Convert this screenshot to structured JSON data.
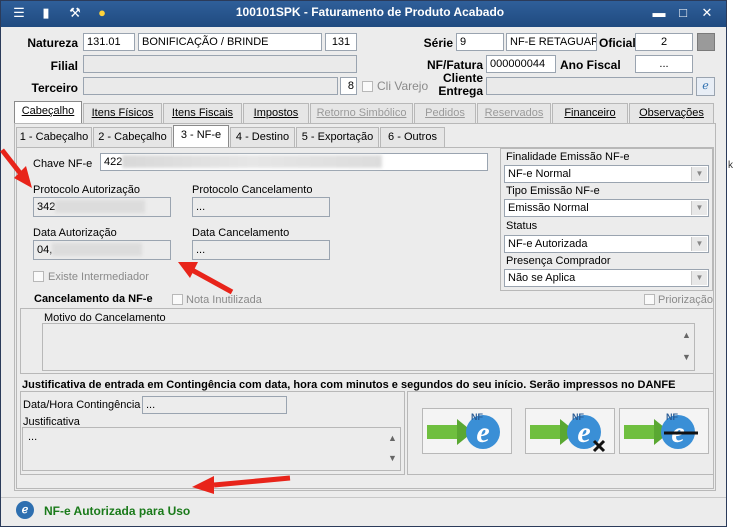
{
  "window": {
    "title": "100101SPK - Faturamento de Produto Acabado",
    "controls": {
      "minimize": "▬",
      "maximize": "□",
      "close": "✕"
    }
  },
  "header": {
    "natureza": {
      "label": "Natureza",
      "code": "131.01",
      "description": "BONIFICAÇÃO / BRINDE",
      "number": "131"
    },
    "filial": {
      "label": "Filial",
      "value": ""
    },
    "terceiro": {
      "label": "Terceiro",
      "number": "8"
    },
    "cli_varejo": {
      "label": "Cli Varejo"
    },
    "serie": {
      "label": "Série",
      "value": "9",
      "description": "NF-E RETAGUARD"
    },
    "oficial": {
      "label": "Oficial",
      "value": "2"
    },
    "nf_fatura": {
      "label": "NF/Fatura",
      "value": "000000044"
    },
    "ano_fiscal": {
      "label": "Ano Fiscal",
      "value": "..."
    },
    "cliente_entrega": {
      "label": "Cliente Entrega",
      "value": ""
    }
  },
  "tabs": [
    {
      "label": "Cabeçalho",
      "state": "active"
    },
    {
      "label": "Itens Físicos",
      "state": "normal"
    },
    {
      "label": "Itens Fiscais",
      "state": "normal"
    },
    {
      "label": "Impostos",
      "state": "normal"
    },
    {
      "label": "Retorno Simbólico",
      "state": "disabled"
    },
    {
      "label": "Pedidos",
      "state": "disabled"
    },
    {
      "label": "Reservados",
      "state": "disabled"
    },
    {
      "label": "Financeiro",
      "state": "normal"
    },
    {
      "label": "Observações",
      "state": "normal"
    }
  ],
  "subtabs": [
    {
      "label": "1 - Cabeçalho"
    },
    {
      "label": "2 - Cabeçalho"
    },
    {
      "label": "3 - NF-e"
    },
    {
      "label": "4 - Destino"
    },
    {
      "label": "5 - Exportação"
    },
    {
      "label": "6 - Outros"
    }
  ],
  "nfe": {
    "chave_label": "Chave NF-e",
    "chave_value": "422",
    "protocolo_autorizacao_label": "Protocolo Autorização",
    "protocolo_autorizacao_value": "342",
    "protocolo_cancelamento_label": "Protocolo Cancelamento",
    "protocolo_cancelamento_value": "...",
    "data_autorizacao_label": "Data Autorização",
    "data_autorizacao_value": "04,",
    "data_cancelamento_label": "Data Cancelamento",
    "data_cancelamento_value": "...",
    "existe_intermediador": "Existe Intermediador"
  },
  "right_panel": {
    "finalidade_label": "Finalidade Emissão NF-e",
    "finalidade_value": "NF-e Normal",
    "tipo_label": "Tipo Emissão NF-e",
    "tipo_value": "Emissão Normal",
    "status_label": "Status",
    "status_value": "NF-e Autorizada",
    "presenca_label": "Presença Comprador",
    "presenca_value": "Não se Aplica"
  },
  "cancelamento": {
    "title": "Cancelamento da NF-e",
    "nota_inutilizada": "Nota Inutilizada",
    "priorizacao": "Priorização",
    "motivo_label": "Motivo do Cancelamento"
  },
  "contingencia": {
    "title": "Justificativa de entrada em Contingência com data, hora com minutos e segundos do seu início. Serão impressos no DANFE",
    "datahora_label": "Data/Hora Contingência",
    "datahora_value": "...",
    "justificativa_label": "Justificativa",
    "justificativa_value": "..."
  },
  "nfe_buttons": [
    {
      "name": "send",
      "text": "NF"
    },
    {
      "name": "cancel",
      "text": "NF"
    },
    {
      "name": "inutilize",
      "text": "NF"
    }
  ],
  "status_bar": {
    "text": "NF-e Autorizada para Uso",
    "color": "#1a7a1a"
  },
  "colors": {
    "titlebar": "#1f4a80",
    "annotation_arrow": "#e8241a",
    "status_green": "#1a7a1a"
  }
}
